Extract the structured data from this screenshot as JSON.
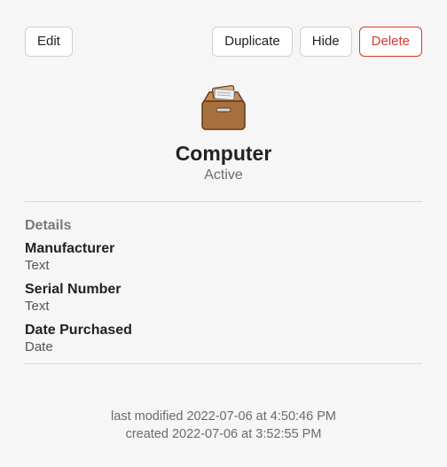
{
  "toolbar": {
    "edit_label": "Edit",
    "duplicate_label": "Duplicate",
    "hide_label": "Hide",
    "delete_label": "Delete"
  },
  "header": {
    "title": "Computer",
    "status": "Active"
  },
  "details": {
    "section_label": "Details",
    "fields": [
      {
        "label": "Manufacturer",
        "value": "Text"
      },
      {
        "label": "Serial Number",
        "value": "Text"
      },
      {
        "label": "Date Purchased",
        "value": "Date"
      }
    ]
  },
  "footer": {
    "modified": "last modified 2022-07-06 at 4:50:46 PM",
    "created": "created 2022-07-06 at 3:52:55 PM"
  }
}
